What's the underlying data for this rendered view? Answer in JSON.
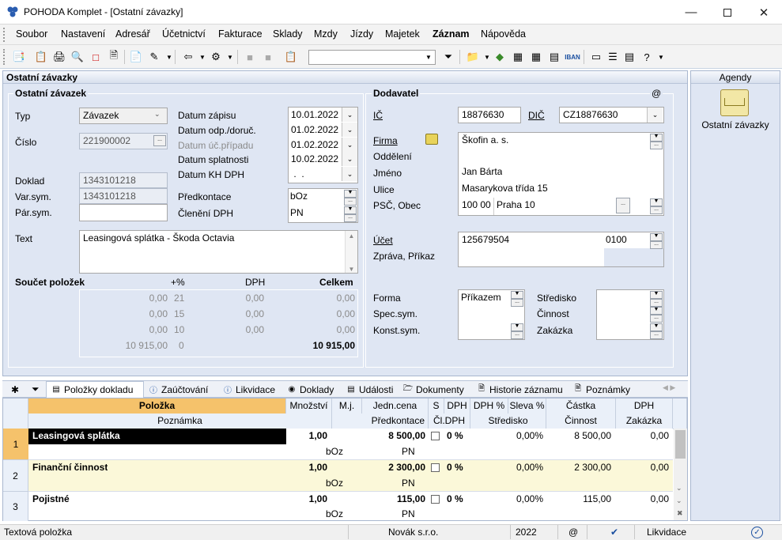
{
  "window": {
    "title": "POHODA Komplet - [Ostatní závazky]"
  },
  "menu": [
    "Soubor",
    "Nastavení",
    "Adresář",
    "Účetnictví",
    "Fakturace",
    "Sklady",
    "Mzdy",
    "Jízdy",
    "Majetek",
    "Záznam",
    "Nápověda"
  ],
  "panel": {
    "title": "Ostatní závazky"
  },
  "zavazek": {
    "group_title": "Ostatní závazek",
    "typ_label": "Typ",
    "typ_value": "Závazek",
    "cislo_label": "Číslo",
    "cislo_value": "221900002",
    "doklad_label": "Doklad",
    "doklad_value": "1343101218",
    "varsym_label": "Var.sym.",
    "varsym_value": "1343101218",
    "parsym_label": "Pár.sym.",
    "parsym_value": "",
    "datum_zapisu_label": "Datum zápisu",
    "datum_zapisu": "10.01.2022",
    "datum_odp_label": "Datum odp./doruč.",
    "datum_odp": "01.02.2022",
    "datum_uc_label": "Datum úč.případu",
    "datum_uc": "01.02.2022",
    "datum_spl_label": "Datum splatnosti",
    "datum_spl": "10.02.2022",
    "datum_kh_label": "Datum KH DPH",
    "datum_kh": " .  .",
    "predkontace_label": "Předkontace",
    "predkontace": "bOz",
    "cleneni_label": "Členění DPH",
    "cleneni": "PN",
    "text_label": "Text",
    "text_value": "Leasingová splátka - Škoda Octavia"
  },
  "soucet": {
    "title": "Součet položek",
    "col_pct": "+%",
    "col_dph": "DPH",
    "col_celkem": "Celkem",
    "rows": [
      {
        "base": "0,00",
        "pct": "21",
        "dph": "0,00",
        "celkem": "0,00"
      },
      {
        "base": "0,00",
        "pct": "15",
        "dph": "0,00",
        "celkem": "0,00"
      },
      {
        "base": "0,00",
        "pct": "10",
        "dph": "0,00",
        "celkem": "0,00"
      },
      {
        "base": "10 915,00",
        "pct": "0",
        "dph": "",
        "celkem": "10 915,00"
      }
    ]
  },
  "dodavatel": {
    "group_title": "Dodavatel",
    "at": "@",
    "ic_label": "IČ",
    "ic": "18876630",
    "dic_label": "DIČ",
    "dic": "CZ18876630",
    "firma_label": "Firma",
    "firma": "Škofin a. s.",
    "oddeleni_label": "Oddělení",
    "oddeleni": "",
    "jmeno_label": "Jméno",
    "jmeno": "Jan Bárta",
    "ulice_label": "Ulice",
    "ulice": "Masarykova třída 15",
    "psc_label": "PSČ, Obec",
    "psc": "100 00",
    "obec": "Praha 10",
    "ucet_label": "Účet",
    "ucet": "125679504",
    "kod_banky": "0100",
    "zprava_label": "Zpráva, Příkaz",
    "forma_label": "Forma",
    "forma": "Příkazem",
    "specsym_label": "Spec.sym.",
    "konstsym_label": "Konst.sym.",
    "stredisko_label": "Středisko",
    "cinnost_label": "Činnost",
    "zakazka_label": "Zakázka"
  },
  "agendy": {
    "title": "Agendy",
    "item": "Ostatní závazky"
  },
  "tabs": [
    "Položky dokladu",
    "Zaúčtování",
    "Likvidace",
    "Doklady",
    "Události",
    "Dokumenty",
    "Historie záznamu",
    "Poznámky"
  ],
  "grid": {
    "headers1": [
      "Položka",
      "Množství",
      "M.j.",
      "Jedn.cena",
      "S",
      "DPH",
      "DPH %",
      "Sleva %",
      "Částka",
      "DPH"
    ],
    "headers2": [
      "Poznámka",
      "Předkontace",
      "Čl.DPH",
      "Středisko",
      "Činnost",
      "Zakázka"
    ],
    "rows": [
      {
        "n": "1",
        "nazev": "Leasingová splátka",
        "mnozstvi": "1,00",
        "cena": "8 500,00",
        "dph": "0 %",
        "sleva": "0,00%",
        "castka": "8 500,00",
        "dphv": "0,00",
        "predkontace": "bOz",
        "cldph": "PN"
      },
      {
        "n": "2",
        "nazev": "Finanční činnost",
        "mnozstvi": "1,00",
        "cena": "2 300,00",
        "dph": "0 %",
        "sleva": "0,00%",
        "castka": "2 300,00",
        "dphv": "0,00",
        "predkontace": "bOz",
        "cldph": "PN"
      },
      {
        "n": "3",
        "nazev": "Pojistné",
        "mnozstvi": "1,00",
        "cena": "115,00",
        "dph": "0 %",
        "sleva": "0,00%",
        "castka": "115,00",
        "dphv": "0,00",
        "predkontace": "bOz",
        "cldph": "PN"
      }
    ]
  },
  "status": {
    "left": "Textová položka",
    "firm": "Novák s.r.o.",
    "year": "2022",
    "at": "@",
    "likvidace": "Likvidace"
  }
}
